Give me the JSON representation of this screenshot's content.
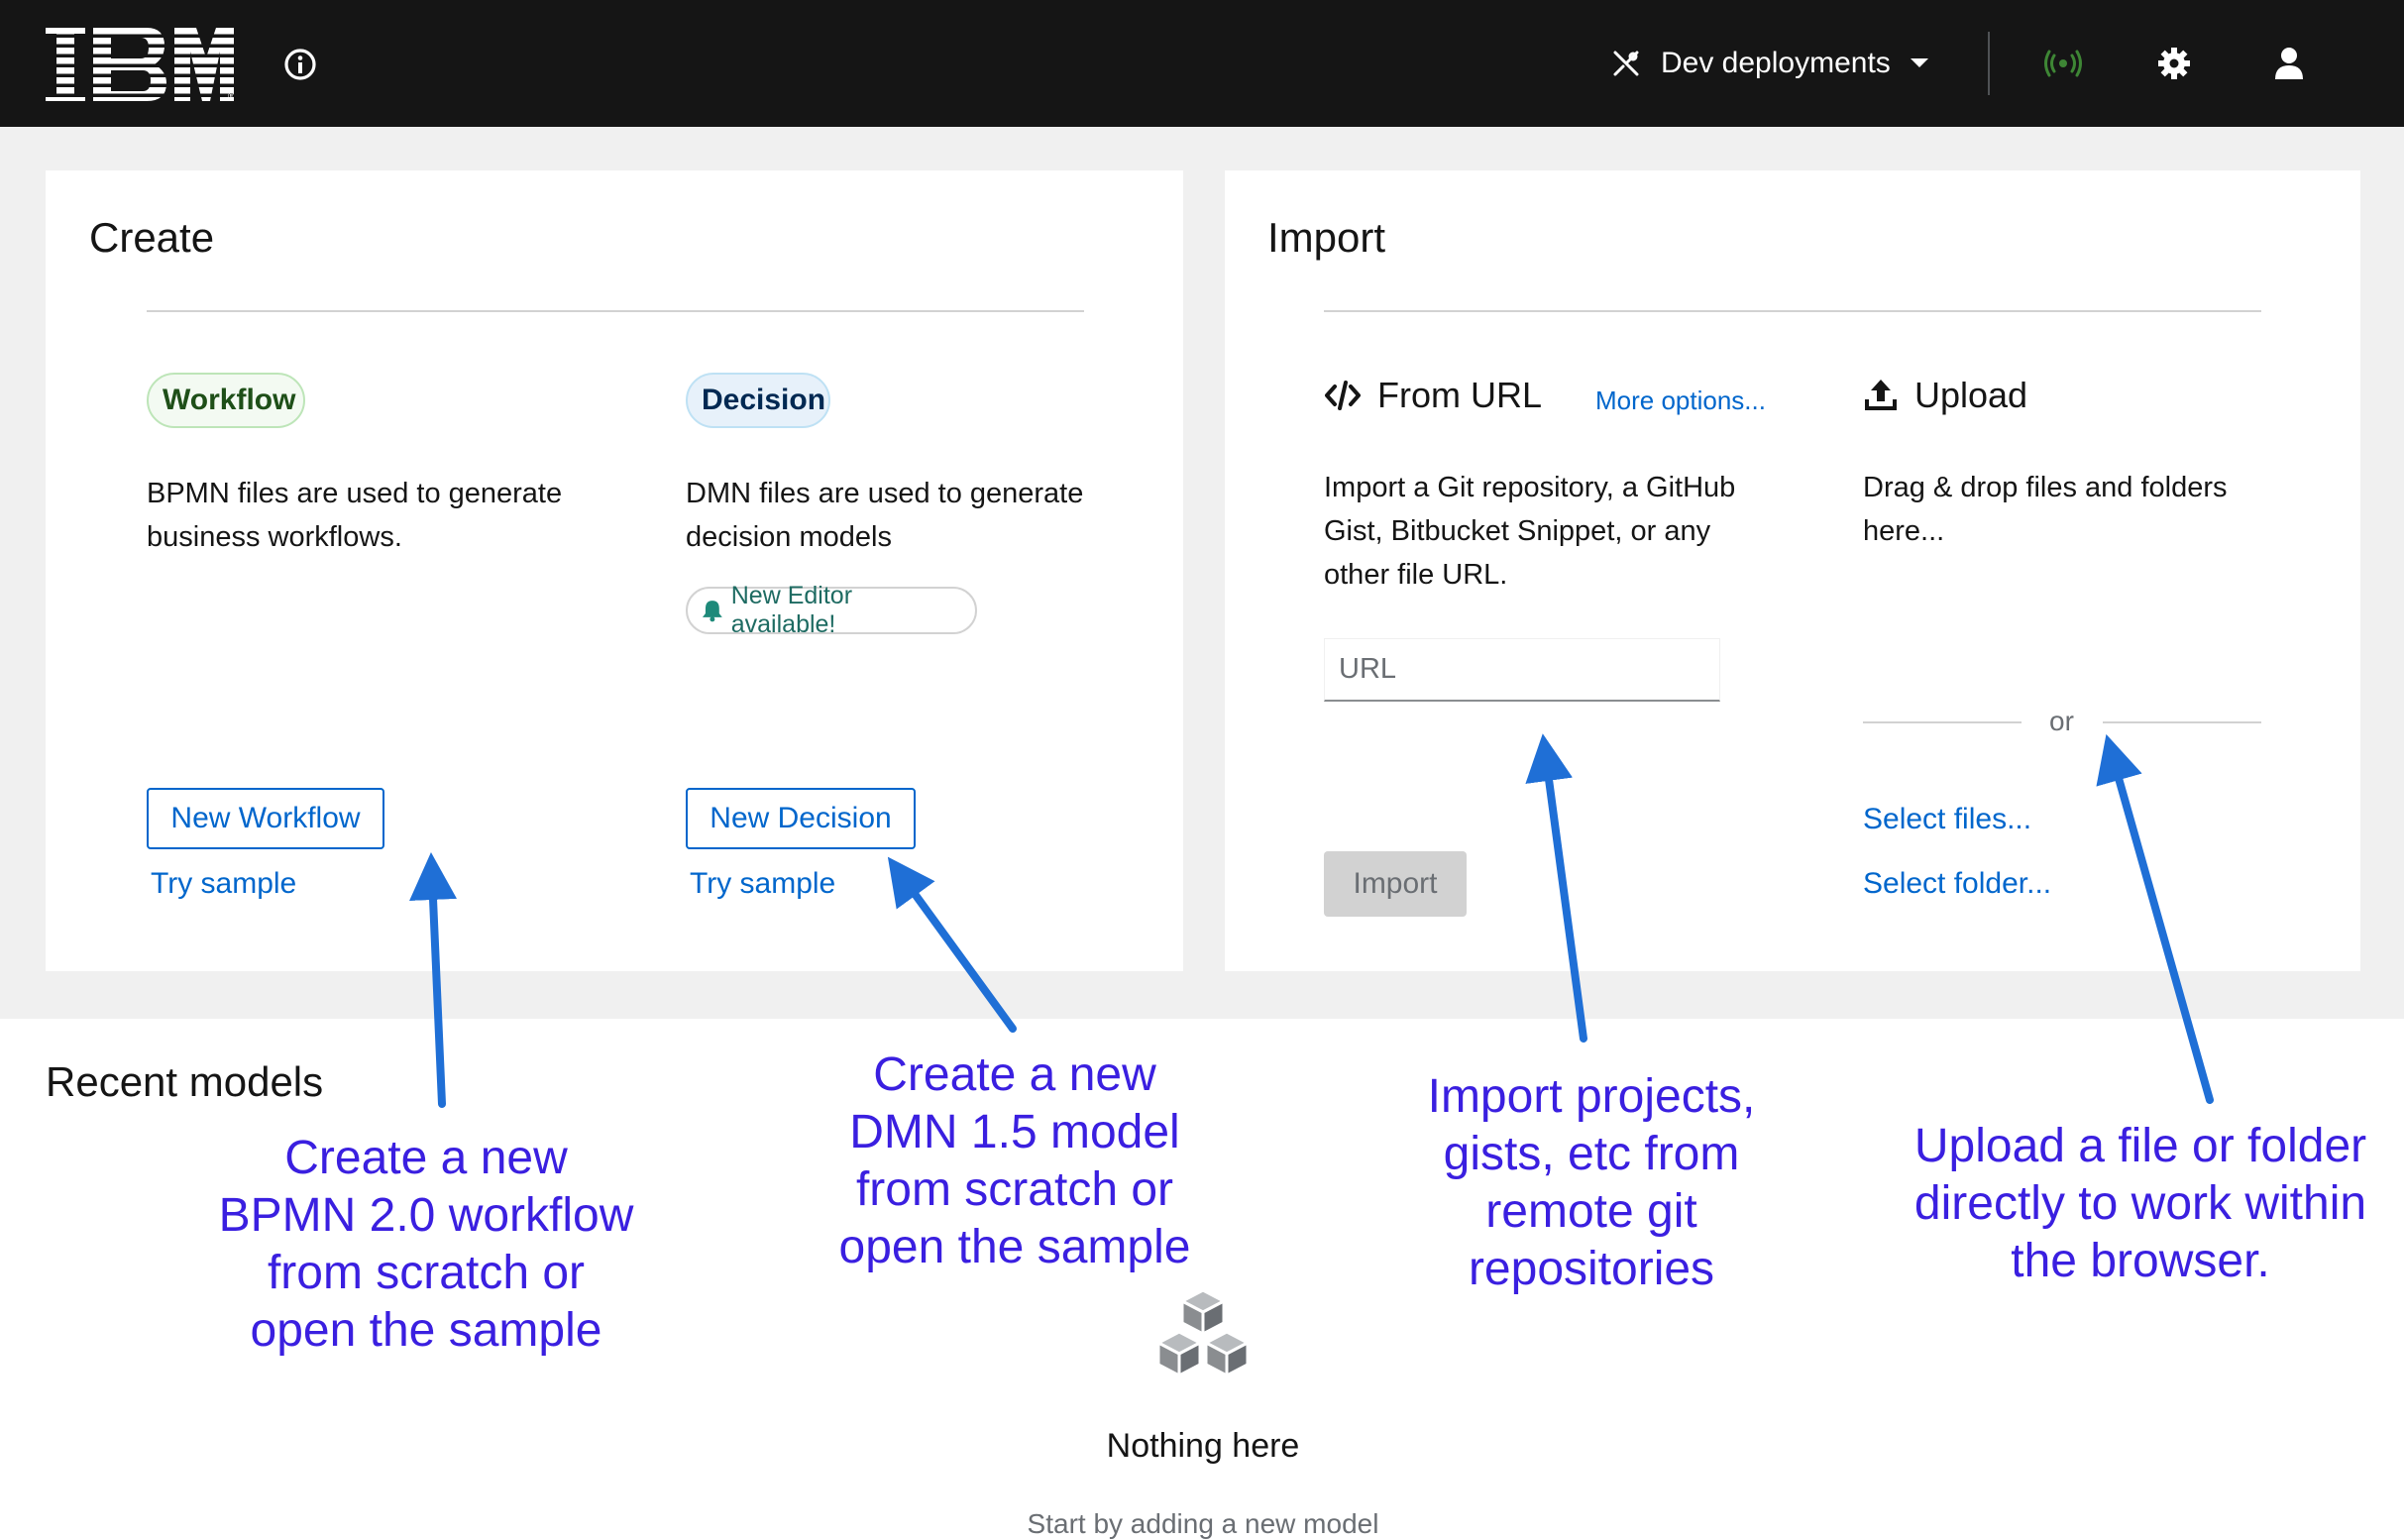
{
  "header": {
    "logo_text": "IBM",
    "deployments_label": "Dev deployments",
    "icons": [
      "info-icon",
      "deploy-icon",
      "chevron-down-icon",
      "broadcast-icon",
      "gear-icon",
      "user-icon"
    ],
    "status_color": "#3e8635"
  },
  "create": {
    "title": "Create",
    "workflow": {
      "label": "Workflow",
      "description": "BPMN files are used to generate business workflows.",
      "button": "New Workflow",
      "sample": "Try sample"
    },
    "decision": {
      "label": "Decision",
      "description": "DMN files are used to generate decision models",
      "notice": "New Editor available!",
      "button": "New Decision",
      "sample": "Try sample"
    }
  },
  "import": {
    "title": "Import",
    "from_url": {
      "label": "From URL",
      "more_options": "More options...",
      "description": "Import a Git repository, a GitHub Gist, Bitbucket Snippet, or any other file URL.",
      "url_placeholder": "URL",
      "url_value": "",
      "button": "Import"
    },
    "upload": {
      "label": "Upload",
      "description": "Drag & drop files and folders here...",
      "or": "or",
      "select_files": "Select files...",
      "select_folder": "Select folder..."
    }
  },
  "recent": {
    "title": "Recent models",
    "empty_title": "Nothing here",
    "empty_subtitle": "Start by adding a new model"
  },
  "annotations": {
    "workflow": [
      "Create a new",
      "BPMN 2.0 workflow",
      "from scratch or",
      "open the sample"
    ],
    "decision": [
      "Create a new",
      "DMN 1.5 model",
      "from scratch or",
      "open the sample"
    ],
    "import": [
      "Import projects,",
      "gists, etc from",
      "remote git",
      "repositories"
    ],
    "upload": [
      "Upload a file or folder",
      "directly to work within",
      "the browser."
    ]
  },
  "colors": {
    "topbar": "#151515",
    "link": "#0066cc",
    "annotation": "#3a1fe0",
    "arrow": "#1f6fd6",
    "workflow_pill_bg": "#f3faf2",
    "workflow_pill_text": "#1e4f18",
    "decision_pill_bg": "#e7f1fa",
    "decision_pill_text": "#002952"
  }
}
